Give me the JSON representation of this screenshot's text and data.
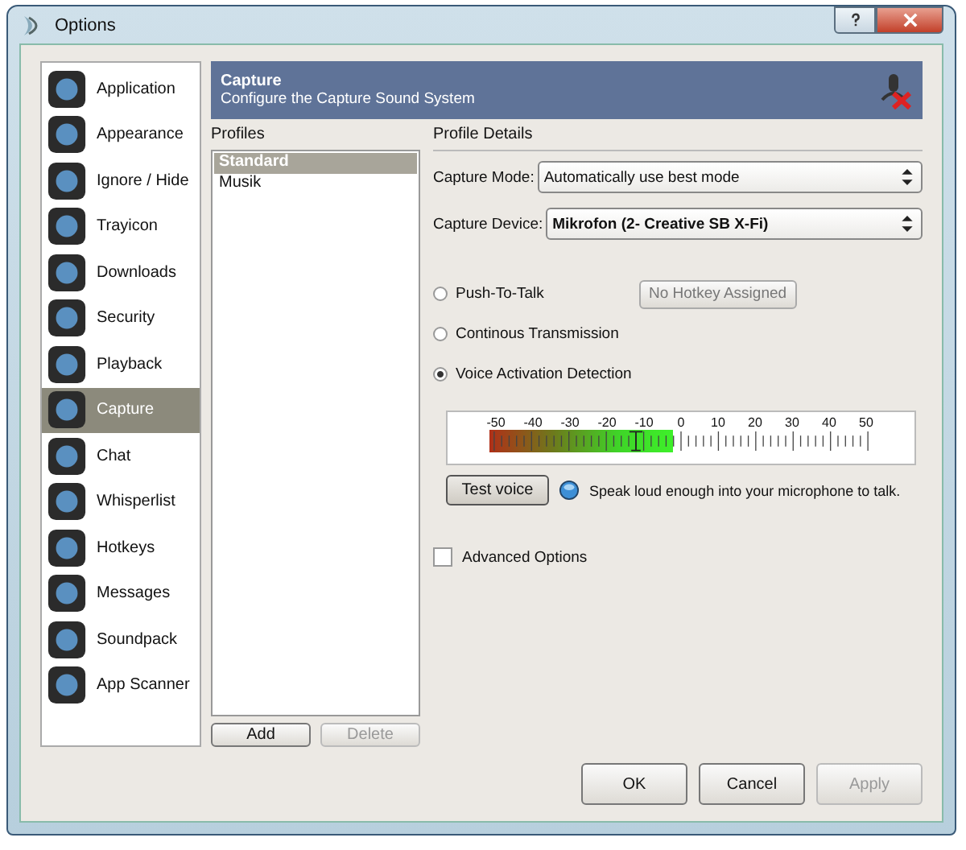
{
  "window": {
    "title": "Options"
  },
  "sidebar": {
    "items": [
      {
        "label": "Application",
        "selected": false
      },
      {
        "label": "Appearance",
        "selected": false
      },
      {
        "label": "Ignore / Hide",
        "selected": false
      },
      {
        "label": "Trayicon",
        "selected": false
      },
      {
        "label": "Downloads",
        "selected": false
      },
      {
        "label": "Security",
        "selected": false
      },
      {
        "label": "Playback",
        "selected": false
      },
      {
        "label": "Capture",
        "selected": true
      },
      {
        "label": "Chat",
        "selected": false
      },
      {
        "label": "Whisperlist",
        "selected": false
      },
      {
        "label": "Hotkeys",
        "selected": false
      },
      {
        "label": "Messages",
        "selected": false
      },
      {
        "label": "Soundpack",
        "selected": false
      },
      {
        "label": "App Scanner",
        "selected": false
      }
    ]
  },
  "header": {
    "title": "Capture",
    "subtitle": "Configure the Capture Sound System"
  },
  "profiles": {
    "heading": "Profiles",
    "items": [
      {
        "label": "Standard",
        "selected": true
      },
      {
        "label": "Musik",
        "selected": false
      }
    ],
    "buttons": [
      {
        "label": "Add",
        "disabled": false
      },
      {
        "label": "Delete",
        "disabled": true
      }
    ]
  },
  "details": {
    "heading": "Profile Details",
    "fields": [
      {
        "label": "Capture Mode:",
        "value": "Automatically use best mode",
        "bold": false
      },
      {
        "label": "Capture Device:",
        "value": "Mikrofon (2- Creative SB X-Fi)",
        "bold": true
      }
    ],
    "modes": [
      {
        "label": "Push-To-Talk",
        "selected": false
      },
      {
        "label": "Continous Transmission",
        "selected": false
      },
      {
        "label": "Voice Activation Detection",
        "selected": true
      }
    ],
    "hotkey_button": "No Hotkey Assigned",
    "meter": {
      "scale": [
        "-50",
        "-40",
        "-30",
        "-20",
        "-10",
        "0",
        "10",
        "20",
        "30",
        "40",
        "50"
      ],
      "level": 0.48
    },
    "test_button": "Test voice",
    "hint": "Speak loud enough into your microphone to talk.",
    "advanced": {
      "label": "Advanced Options",
      "checked": false
    }
  },
  "footer": {
    "buttons": [
      {
        "label": "OK",
        "disabled": false
      },
      {
        "label": "Cancel",
        "disabled": false
      },
      {
        "label": "Apply",
        "disabled": true
      }
    ]
  }
}
